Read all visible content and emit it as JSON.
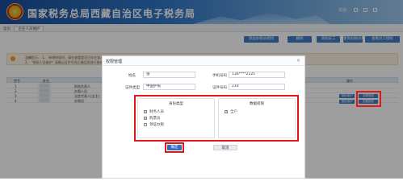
{
  "header": {
    "title": "国家税务总局西藏自治区电子税务局",
    "user_text": "欢迎      ",
    "right_icons": [
      "home-icon",
      "message-icon",
      "logout-icon"
    ]
  },
  "breadcrumb": {
    "home": "首页",
    "current_tab": "企业人员维护"
  },
  "toolbar": {
    "buttons": [
      "添加办税员授权",
      "删除",
      "添加员工",
      "查询办税员授权",
      "查看员工授权"
    ]
  },
  "notice": {
    "lines": [
      "温馨提示：  1、     新增授权时，请先查看是否已存在该人员信息，再进行授权操作",
      "         2、     \"授权人员维护\" 请确认证件号码正确后再进行维护"
    ]
  },
  "table": {
    "headers": [
      "序号",
      "姓名",
      "",
      "",
      "",
      "",
      "操作"
    ],
    "rows": [
      {
        "no": "1",
        "role": "财务负责人"
      },
      {
        "no": "2",
        "role": "办税人员"
      },
      {
        "no": "3",
        "role": "法定代表人(业主)"
      },
      {
        "no": "4",
        "role": "办税员"
      }
    ],
    "op_buttons": [
      "授权维护",
      "查看授权"
    ]
  },
  "modal": {
    "title": "权限管理",
    "name_label": "姓名",
    "name_value": "张",
    "phone_label": "手机号码",
    "phone_value": "136****2125",
    "idtype_label": "证件类型",
    "idtype_value": "中国护照",
    "idno_label": "证件号码",
    "idno_value": "210",
    "left_panel_title": "身份类型",
    "left_options": [
      {
        "label": "财务人员",
        "checked": true
      },
      {
        "label": "购票员",
        "checked": true
      },
      {
        "label": "领证办税",
        "checked": false
      }
    ],
    "right_panel_title": "数据权限",
    "right_options": [
      {
        "label": "全户",
        "checked": true
      }
    ],
    "confirm_label": "确定",
    "cancel_label": "取消"
  },
  "colors": {
    "accent": "#2f6fc0",
    "highlight": "#e01818",
    "header": "#1a4f9c"
  }
}
